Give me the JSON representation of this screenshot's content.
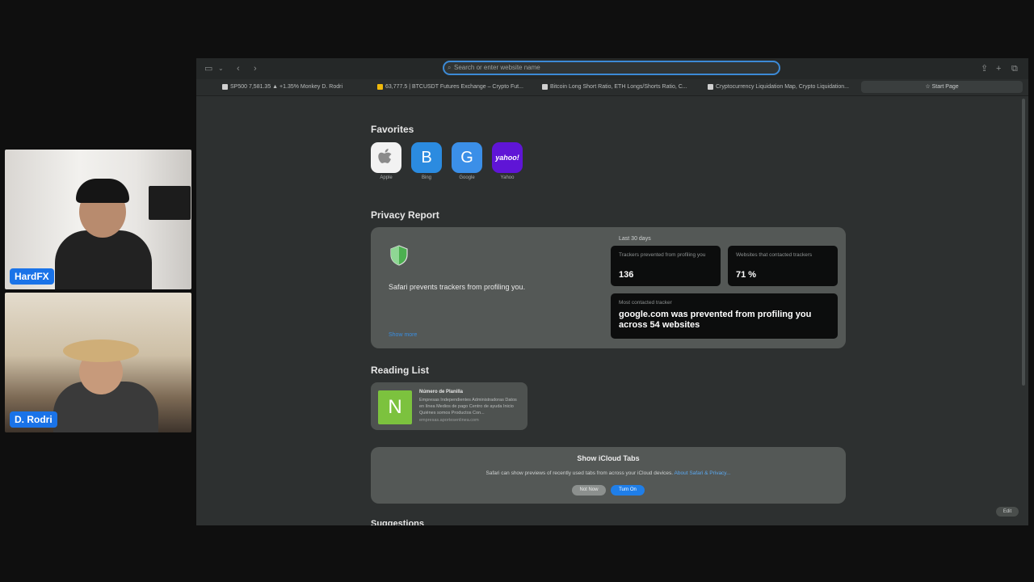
{
  "participants": [
    {
      "name": "HardFX"
    },
    {
      "name": "D. Rodri"
    }
  ],
  "browser": {
    "address_placeholder": "Search or enter website name",
    "favorites_bar": [
      {
        "label": "SP500 7,581.35 ▲ +1.35% Monkey D. Rodri"
      },
      {
        "label": "63,777.5 | BTCUSDT Futures Exchange – Crypto Fut..."
      },
      {
        "label": "Bitcoin Long Short Ratio, ETH Longs/Shorts Ratio, C..."
      },
      {
        "label": "Cryptocurrency Liquidation Map, Crypto Liquidation..."
      }
    ],
    "start_page_label": "Start Page",
    "edit_label": "Edit"
  },
  "favorites": {
    "title": "Favorites",
    "items": [
      {
        "name": "Apple",
        "glyph": "",
        "color": "#f2f2f2"
      },
      {
        "name": "Bing",
        "glyph": "B",
        "color": "#2b8be0"
      },
      {
        "name": "Google",
        "glyph": "G",
        "color": "#3b8fe8"
      },
      {
        "name": "Yahoo",
        "glyph": "yahoo!",
        "color": "#5f15d6"
      }
    ]
  },
  "privacy": {
    "title": "Privacy Report",
    "message": "Safari prevents trackers from profiling you.",
    "link": "Show more",
    "period": "Last 30 days",
    "trackers_caption": "Trackers prevented from profiling you",
    "trackers_value": "136",
    "websites_caption": "Websites that contacted trackers",
    "websites_value": "71 %",
    "most_caption": "Most contacted tracker",
    "most_text": "google.com was prevented from profiling you across 54 websites"
  },
  "reading_list": {
    "title": "Reading List",
    "item": {
      "icon_letter": "N",
      "title": "Número de Planilla",
      "description": "Empresas Independientes Administradoras Datos en línea Medios de pago Centro de ayuda Inicio Quiénes somos Productos Con...",
      "url": "empresas.aportesenlinea.com"
    }
  },
  "icloud": {
    "title": "Show iCloud Tabs",
    "description": "Safari can show previews of recently used tabs from across your iCloud devices.",
    "link": "About Safari & Privacy...",
    "not_now": "Not Now",
    "turn_on": "Turn On"
  },
  "suggestions": {
    "title": "Suggestions"
  },
  "colors": {
    "accent": "#1f7ee8",
    "shield": "#4caf50",
    "reading_icon": "#7cc23e"
  }
}
